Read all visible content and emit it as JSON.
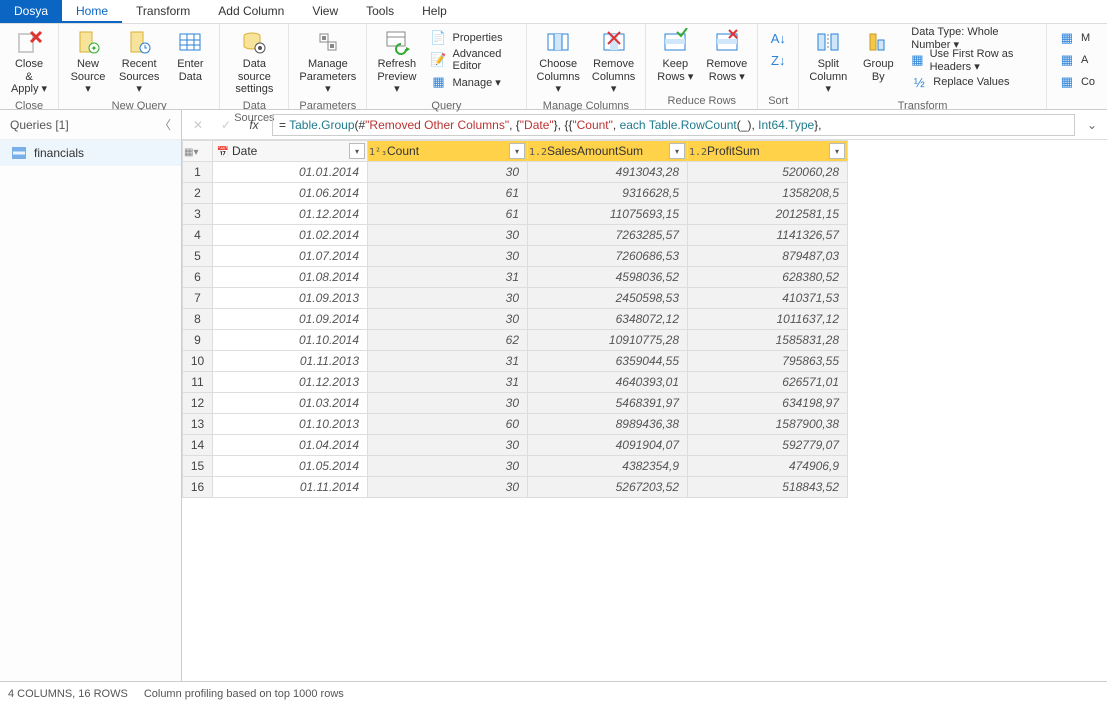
{
  "menu": {
    "file": "Dosya",
    "home": "Home",
    "transform": "Transform",
    "addcol": "Add Column",
    "view": "View",
    "tools": "Tools",
    "help": "Help"
  },
  "ribbon": {
    "close": {
      "label": "Close &\nApply ▾",
      "group": "Close"
    },
    "newquery": {
      "new": "New\nSource ▾",
      "recent": "Recent\nSources ▾",
      "enter": "Enter\nData",
      "group": "New Query"
    },
    "datasources": {
      "btn": "Data source\nsettings",
      "group": "Data Sources"
    },
    "parameters": {
      "btn": "Manage\nParameters ▾",
      "group": "Parameters"
    },
    "query": {
      "refresh": "Refresh\nPreview ▾",
      "props": "Properties",
      "adv": "Advanced Editor",
      "manage": "Manage ▾",
      "group": "Query"
    },
    "managecols": {
      "choose": "Choose\nColumns ▾",
      "remove": "Remove\nColumns ▾",
      "group": "Manage Columns"
    },
    "reducerows": {
      "keep": "Keep\nRows ▾",
      "remove": "Remove\nRows ▾",
      "group": "Reduce Rows"
    },
    "sort": {
      "group": "Sort"
    },
    "split": {
      "btn": "Split\nColumn ▾"
    },
    "groupby": {
      "btn": "Group\nBy"
    },
    "transform": {
      "datatype": "Data Type: Whole Number ▾",
      "firstrow": "Use First Row as Headers ▾",
      "replace": "Replace Values",
      "group": "Transform"
    },
    "extra1": "M",
    "extra2": "A",
    "extra3": "Co"
  },
  "queries": {
    "title": "Queries [1]",
    "item": "financials"
  },
  "formula": {
    "fx": "fx",
    "text": "= Table.Group(#\"Removed Other Columns\", {\"Date\"}, {{\"Count\", each Table.RowCount(_), Int64.Type},"
  },
  "columns": {
    "date": "Date",
    "count": "Count",
    "sales": "SalesAmountSum",
    "profit": "ProfitSum"
  },
  "coltypeicons": {
    "date": "📅",
    "count": "1²₃",
    "sales": "1.2",
    "profit": "1.2"
  },
  "rows": [
    {
      "n": 1,
      "date": "01.01.2014",
      "count": "30",
      "sales": "4913043,28",
      "profit": "520060,28"
    },
    {
      "n": 2,
      "date": "01.06.2014",
      "count": "61",
      "sales": "9316628,5",
      "profit": "1358208,5"
    },
    {
      "n": 3,
      "date": "01.12.2014",
      "count": "61",
      "sales": "11075693,15",
      "profit": "2012581,15"
    },
    {
      "n": 4,
      "date": "01.02.2014",
      "count": "30",
      "sales": "7263285,57",
      "profit": "1141326,57"
    },
    {
      "n": 5,
      "date": "01.07.2014",
      "count": "30",
      "sales": "7260686,53",
      "profit": "879487,03"
    },
    {
      "n": 6,
      "date": "01.08.2014",
      "count": "31",
      "sales": "4598036,52",
      "profit": "628380,52"
    },
    {
      "n": 7,
      "date": "01.09.2013",
      "count": "30",
      "sales": "2450598,53",
      "profit": "410371,53"
    },
    {
      "n": 8,
      "date": "01.09.2014",
      "count": "30",
      "sales": "6348072,12",
      "profit": "1011637,12"
    },
    {
      "n": 9,
      "date": "01.10.2014",
      "count": "62",
      "sales": "10910775,28",
      "profit": "1585831,28"
    },
    {
      "n": 10,
      "date": "01.11.2013",
      "count": "31",
      "sales": "6359044,55",
      "profit": "795863,55"
    },
    {
      "n": 11,
      "date": "01.12.2013",
      "count": "31",
      "sales": "4640393,01",
      "profit": "626571,01"
    },
    {
      "n": 12,
      "date": "01.03.2014",
      "count": "30",
      "sales": "5468391,97",
      "profit": "634198,97"
    },
    {
      "n": 13,
      "date": "01.10.2013",
      "count": "60",
      "sales": "8989436,38",
      "profit": "1587900,38"
    },
    {
      "n": 14,
      "date": "01.04.2014",
      "count": "30",
      "sales": "4091904,07",
      "profit": "592779,07"
    },
    {
      "n": 15,
      "date": "01.05.2014",
      "count": "30",
      "sales": "4382354,9",
      "profit": "474906,9"
    },
    {
      "n": 16,
      "date": "01.11.2014",
      "count": "30",
      "sales": "5267203,52",
      "profit": "518843,52"
    }
  ],
  "status": {
    "cols": "4 COLUMNS, 16 ROWS",
    "profiling": "Column profiling based on top 1000 rows"
  }
}
